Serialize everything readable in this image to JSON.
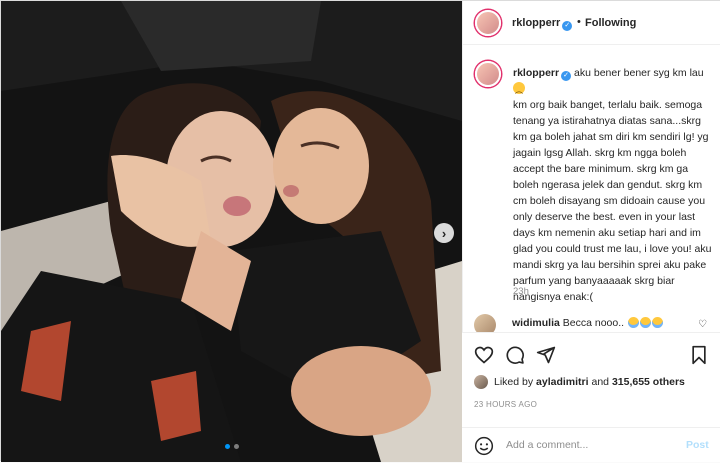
{
  "post": {
    "username": "rklopperr",
    "follow_status": "Following",
    "separator": "•",
    "caption_lead": "aku bener bener syg km lau",
    "caption_body": "km org baik banget, terlalu baik. semoga tenang ya istirahatnya diatas sana...skrg km ga boleh jahat sm diri km sendiri lg! yg jagain lgsg Allah. skrg km ngga boleh accept the bare minimum. skrg km ga boleh ngerasa jelek dan gendut. skrg km cm boleh disayang sm didoain cause you only deserve the best. even in your last days km nemenin aku setiap hari and im glad you could trust me lau, i love you! aku mandi skrg ya lau bersihin sprei aku pake parfum yang banyaaaaak skrg biar nangisnya enak:(",
    "caption_time": "23h",
    "comment": {
      "username": "widimulia",
      "text": "Becca nooo.."
    },
    "likes": {
      "prefix": "Liked by",
      "user": "ayladimitri",
      "conj": "and",
      "count": "315,655 others"
    },
    "timestamp": "23 HOURS AGO",
    "add_comment_placeholder": "Add a comment...",
    "post_label": "Post",
    "carousel": {
      "count": 2,
      "active": 1
    }
  },
  "icons": {
    "like": "heart-icon",
    "comment": "comment-icon",
    "share": "share-icon",
    "save": "bookmark-icon",
    "emoji": "emoji-icon",
    "next": "chevron-right-icon"
  },
  "colors": {
    "accent": "#0095f6",
    "verified": "#3897f0",
    "story_ring": "#e1306c",
    "post_disabled": "#b2dffc"
  }
}
